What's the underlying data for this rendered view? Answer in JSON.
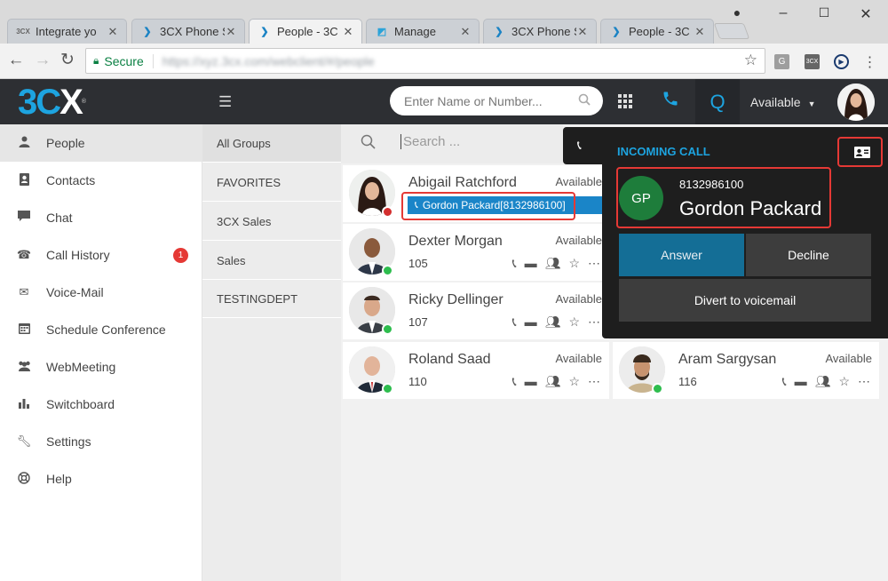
{
  "browser": {
    "tabs": [
      {
        "title": "Integrate yo",
        "icon": "3cx-favicon-icon",
        "active": false
      },
      {
        "title": "3CX Phone S",
        "icon": "3cx-chevron-favicon-icon",
        "active": false
      },
      {
        "title": "People - 3C",
        "icon": "3cx-chevron-favicon-icon",
        "active": true
      },
      {
        "title": "Manage",
        "icon": "manage-favicon-icon",
        "active": false
      },
      {
        "title": "3CX Phone S",
        "icon": "3cx-chevron-favicon-icon",
        "active": false
      },
      {
        "title": "People - 3C",
        "icon": "3cx-chevron-favicon-icon",
        "active": false
      }
    ],
    "secure_label": "Secure",
    "url_text": "https://xyz.3cx.com/webclient/#/people"
  },
  "header": {
    "logo_text": "3C",
    "logo_x": "X",
    "dialer_placeholder": "Enter Name or Number...",
    "q_label": "Q",
    "status_label": "Available"
  },
  "sidebar": {
    "items": [
      {
        "label": "People",
        "icon": "person-icon"
      },
      {
        "label": "Contacts",
        "icon": "contacts-icon"
      },
      {
        "label": "Chat",
        "icon": "chat-icon"
      },
      {
        "label": "Call History",
        "icon": "phone-icon"
      },
      {
        "label": "Voice-Mail",
        "icon": "mail-icon"
      },
      {
        "label": "Schedule Conference",
        "icon": "calendar-icon"
      },
      {
        "label": "WebMeeting",
        "icon": "users-icon"
      },
      {
        "label": "Switchboard",
        "icon": "bar-chart-icon"
      },
      {
        "label": "Settings",
        "icon": "wrench-icon"
      },
      {
        "label": "Help",
        "icon": "lifebuoy-icon"
      }
    ],
    "call_history_badge": "1"
  },
  "groups": {
    "items": [
      "All Groups",
      "FAVORITES",
      "3CX Sales",
      "Sales",
      "TESTINGDEPT"
    ]
  },
  "main": {
    "search_placeholder": "Search ...",
    "people": [
      {
        "name": "Abigail Ratchford",
        "status": "Available",
        "ext": "",
        "presence_color": "#d32f2f"
      },
      {
        "name": "Dexter Morgan",
        "status": "Available",
        "ext": "105",
        "presence_color": "#2ebd4e"
      },
      {
        "name": "Ricky Dellinger",
        "status": "Available",
        "ext": "107",
        "presence_color": "#2ebd4e"
      },
      {
        "name": "Roland Saad",
        "status": "Available",
        "ext": "110",
        "presence_color": "#2ebd4e"
      },
      {
        "name": "Aram Sargysan",
        "status": "Available",
        "ext": "116",
        "presence_color": "#2ebd4e"
      }
    ],
    "active_call_chip": "Gordon Packard[8132986100]"
  },
  "incoming_call": {
    "title": "INCOMING CALL",
    "initials": "GP",
    "number": "8132986100",
    "caller_name": "Gordon Packard",
    "answer_label": "Answer",
    "decline_label": "Decline",
    "divert_label": "Divert to voicemail"
  }
}
